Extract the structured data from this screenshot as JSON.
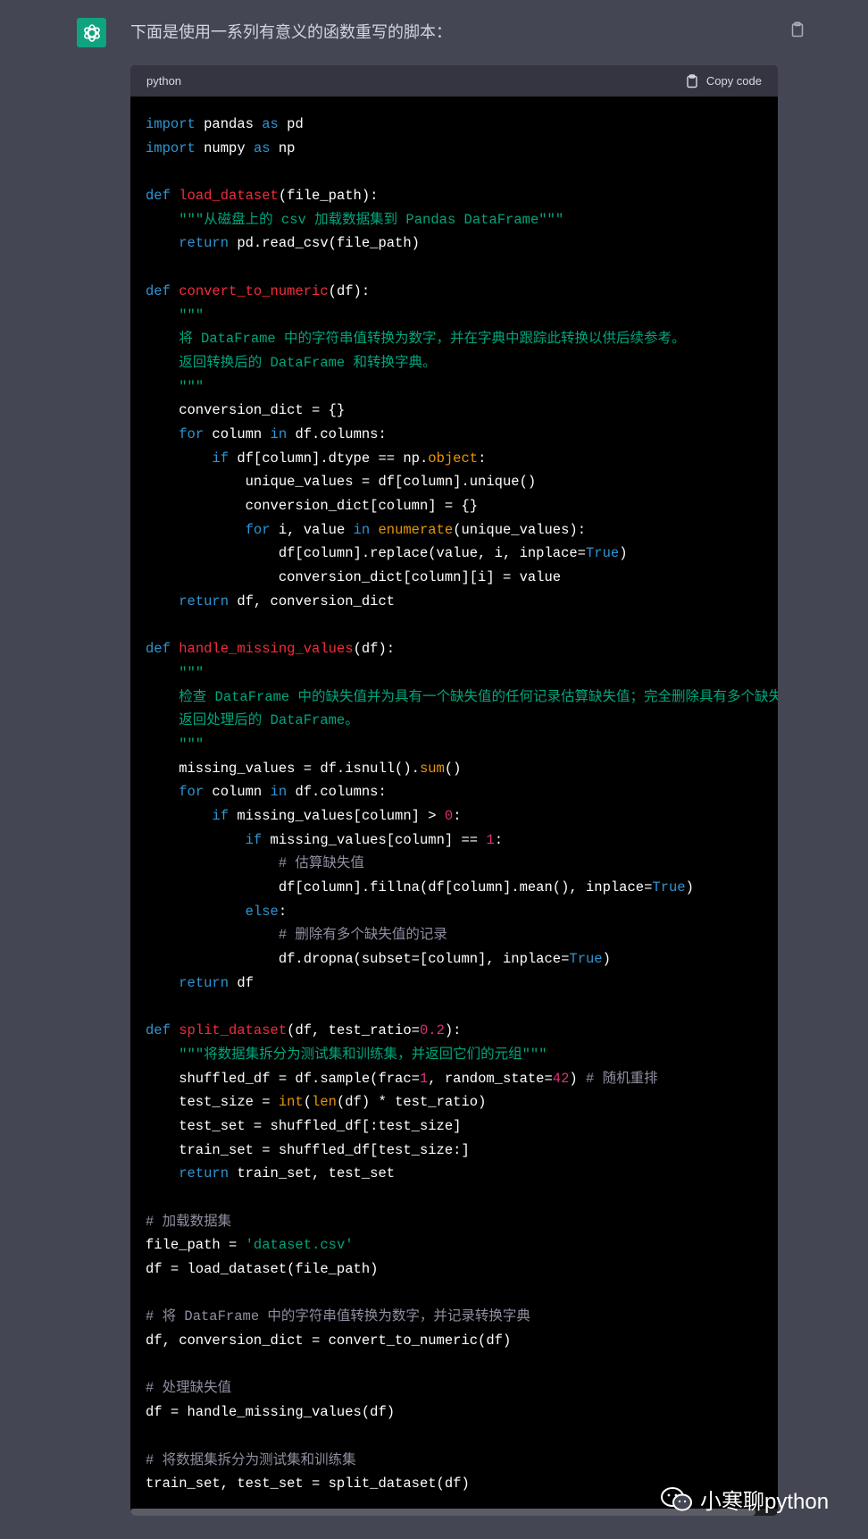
{
  "message": {
    "intro": "下面是使用一系列有意义的函数重写的脚本："
  },
  "code_block": {
    "language": "python",
    "copy_label": "Copy code",
    "lines": [
      [
        {
          "t": "import",
          "c": "kw"
        },
        {
          "t": " pandas "
        },
        {
          "t": "as",
          "c": "kw"
        },
        {
          "t": " pd"
        }
      ],
      [
        {
          "t": "import",
          "c": "kw"
        },
        {
          "t": " numpy "
        },
        {
          "t": "as",
          "c": "kw"
        },
        {
          "t": " np"
        }
      ],
      [],
      [
        {
          "t": "def",
          "c": "kw"
        },
        {
          "t": " "
        },
        {
          "t": "load_dataset",
          "c": "fn"
        },
        {
          "t": "(file_path):"
        }
      ],
      [
        {
          "t": "    "
        },
        {
          "t": "\"\"\"从磁盘上的 csv 加载数据集到 Pandas DataFrame\"\"\"",
          "c": "str"
        }
      ],
      [
        {
          "t": "    "
        },
        {
          "t": "return",
          "c": "kw"
        },
        {
          "t": " pd.read_csv(file_path)"
        }
      ],
      [],
      [
        {
          "t": "def",
          "c": "kw"
        },
        {
          "t": " "
        },
        {
          "t": "convert_to_numeric",
          "c": "fn"
        },
        {
          "t": "(df):"
        }
      ],
      [
        {
          "t": "    "
        },
        {
          "t": "\"\"\"",
          "c": "str"
        }
      ],
      [
        {
          "t": "    "
        },
        {
          "t": "将 DataFrame 中的字符串值转换为数字，并在字典中跟踪此转换以供后续参考。",
          "c": "str"
        }
      ],
      [
        {
          "t": "    "
        },
        {
          "t": "返回转换后的 DataFrame 和转换字典。",
          "c": "str"
        }
      ],
      [
        {
          "t": "    "
        },
        {
          "t": "\"\"\"",
          "c": "str"
        }
      ],
      [
        {
          "t": "    conversion_dict = {}"
        }
      ],
      [
        {
          "t": "    "
        },
        {
          "t": "for",
          "c": "kw"
        },
        {
          "t": " column "
        },
        {
          "t": "in",
          "c": "kw"
        },
        {
          "t": " df.columns:"
        }
      ],
      [
        {
          "t": "        "
        },
        {
          "t": "if",
          "c": "kw"
        },
        {
          "t": " df[column].dtype == np."
        },
        {
          "t": "object",
          "c": "bi"
        },
        {
          "t": ":"
        }
      ],
      [
        {
          "t": "            unique_values = df[column].unique()"
        }
      ],
      [
        {
          "t": "            conversion_dict[column] = {}"
        }
      ],
      [
        {
          "t": "            "
        },
        {
          "t": "for",
          "c": "kw"
        },
        {
          "t": " i, value "
        },
        {
          "t": "in",
          "c": "kw"
        },
        {
          "t": " "
        },
        {
          "t": "enumerate",
          "c": "bi"
        },
        {
          "t": "(unique_values):"
        }
      ],
      [
        {
          "t": "                df[column].replace(value, i, inplace="
        },
        {
          "t": "True",
          "c": "kw"
        },
        {
          "t": ")"
        }
      ],
      [
        {
          "t": "                conversion_dict[column][i] = value"
        }
      ],
      [
        {
          "t": "    "
        },
        {
          "t": "return",
          "c": "kw"
        },
        {
          "t": " df, conversion_dict"
        }
      ],
      [],
      [
        {
          "t": "def",
          "c": "kw"
        },
        {
          "t": " "
        },
        {
          "t": "handle_missing_values",
          "c": "fn"
        },
        {
          "t": "(df):"
        }
      ],
      [
        {
          "t": "    "
        },
        {
          "t": "\"\"\"",
          "c": "str"
        }
      ],
      [
        {
          "t": "    "
        },
        {
          "t": "检查 DataFrame 中的缺失值并为具有一个缺失值的任何记录估算缺失值；完全删除具有多个缺失",
          "c": "str"
        }
      ],
      [
        {
          "t": "    "
        },
        {
          "t": "返回处理后的 DataFrame。",
          "c": "str"
        }
      ],
      [
        {
          "t": "    "
        },
        {
          "t": "\"\"\"",
          "c": "str"
        }
      ],
      [
        {
          "t": "    missing_values = df.isnull()."
        },
        {
          "t": "sum",
          "c": "bi"
        },
        {
          "t": "()"
        }
      ],
      [
        {
          "t": "    "
        },
        {
          "t": "for",
          "c": "kw"
        },
        {
          "t": " column "
        },
        {
          "t": "in",
          "c": "kw"
        },
        {
          "t": " df.columns:"
        }
      ],
      [
        {
          "t": "        "
        },
        {
          "t": "if",
          "c": "kw"
        },
        {
          "t": " missing_values[column] > "
        },
        {
          "t": "0",
          "c": "num"
        },
        {
          "t": ":"
        }
      ],
      [
        {
          "t": "            "
        },
        {
          "t": "if",
          "c": "kw"
        },
        {
          "t": " missing_values[column] == "
        },
        {
          "t": "1",
          "c": "num"
        },
        {
          "t": ":"
        }
      ],
      [
        {
          "t": "                "
        },
        {
          "t": "# 估算缺失值",
          "c": "cm"
        }
      ],
      [
        {
          "t": "                df[column].fillna(df[column].mean(), inplace="
        },
        {
          "t": "True",
          "c": "kw"
        },
        {
          "t": ")"
        }
      ],
      [
        {
          "t": "            "
        },
        {
          "t": "else",
          "c": "kw"
        },
        {
          "t": ":"
        }
      ],
      [
        {
          "t": "                "
        },
        {
          "t": "# 删除有多个缺失值的记录",
          "c": "cm"
        }
      ],
      [
        {
          "t": "                df.dropna(subset=[column], inplace="
        },
        {
          "t": "True",
          "c": "kw"
        },
        {
          "t": ")"
        }
      ],
      [
        {
          "t": "    "
        },
        {
          "t": "return",
          "c": "kw"
        },
        {
          "t": " df"
        }
      ],
      [],
      [
        {
          "t": "def",
          "c": "kw"
        },
        {
          "t": " "
        },
        {
          "t": "split_dataset",
          "c": "fn"
        },
        {
          "t": "(df, test_ratio="
        },
        {
          "t": "0.2",
          "c": "num"
        },
        {
          "t": "):"
        }
      ],
      [
        {
          "t": "    "
        },
        {
          "t": "\"\"\"将数据集拆分为测试集和训练集，并返回它们的元组\"\"\"",
          "c": "str"
        }
      ],
      [
        {
          "t": "    shuffled_df = df.sample(frac="
        },
        {
          "t": "1",
          "c": "num"
        },
        {
          "t": ", random_state="
        },
        {
          "t": "42",
          "c": "num"
        },
        {
          "t": ") "
        },
        {
          "t": "# 随机重排",
          "c": "cm"
        }
      ],
      [
        {
          "t": "    test_size = "
        },
        {
          "t": "int",
          "c": "bi"
        },
        {
          "t": "("
        },
        {
          "t": "len",
          "c": "bi"
        },
        {
          "t": "(df) * test_ratio)"
        }
      ],
      [
        {
          "t": "    test_set = shuffled_df[:test_size]"
        }
      ],
      [
        {
          "t": "    train_set = shuffled_df[test_size:]"
        }
      ],
      [
        {
          "t": "    "
        },
        {
          "t": "return",
          "c": "kw"
        },
        {
          "t": " train_set, test_set"
        }
      ],
      [],
      [
        {
          "t": "# 加载数据集",
          "c": "cm"
        }
      ],
      [
        {
          "t": "file_path = "
        },
        {
          "t": "'dataset.csv'",
          "c": "str"
        }
      ],
      [
        {
          "t": "df = load_dataset(file_path)"
        }
      ],
      [],
      [
        {
          "t": "# 将 DataFrame 中的字符串值转换为数字，并记录转换字典",
          "c": "cm"
        }
      ],
      [
        {
          "t": "df, conversion_dict = convert_to_numeric(df)"
        }
      ],
      [],
      [
        {
          "t": "# 处理缺失值",
          "c": "cm"
        }
      ],
      [
        {
          "t": "df = handle_missing_values(df)"
        }
      ],
      [],
      [
        {
          "t": "# 将数据集拆分为测试集和训练集",
          "c": "cm"
        }
      ],
      [
        {
          "t": "train_set, test_set = split_dataset(df)"
        }
      ]
    ]
  },
  "watermark": {
    "text": "小寒聊python",
    "icon": "wechat-icon"
  },
  "colors": {
    "background": "#444654",
    "avatar": "#10a37f",
    "code_bg": "#000000",
    "keyword": "#2e95d3",
    "function": "#f22c3d",
    "string": "#00a67d",
    "number": "#df3079",
    "builtin": "#e9950c",
    "comment": "#8e8ea0"
  }
}
